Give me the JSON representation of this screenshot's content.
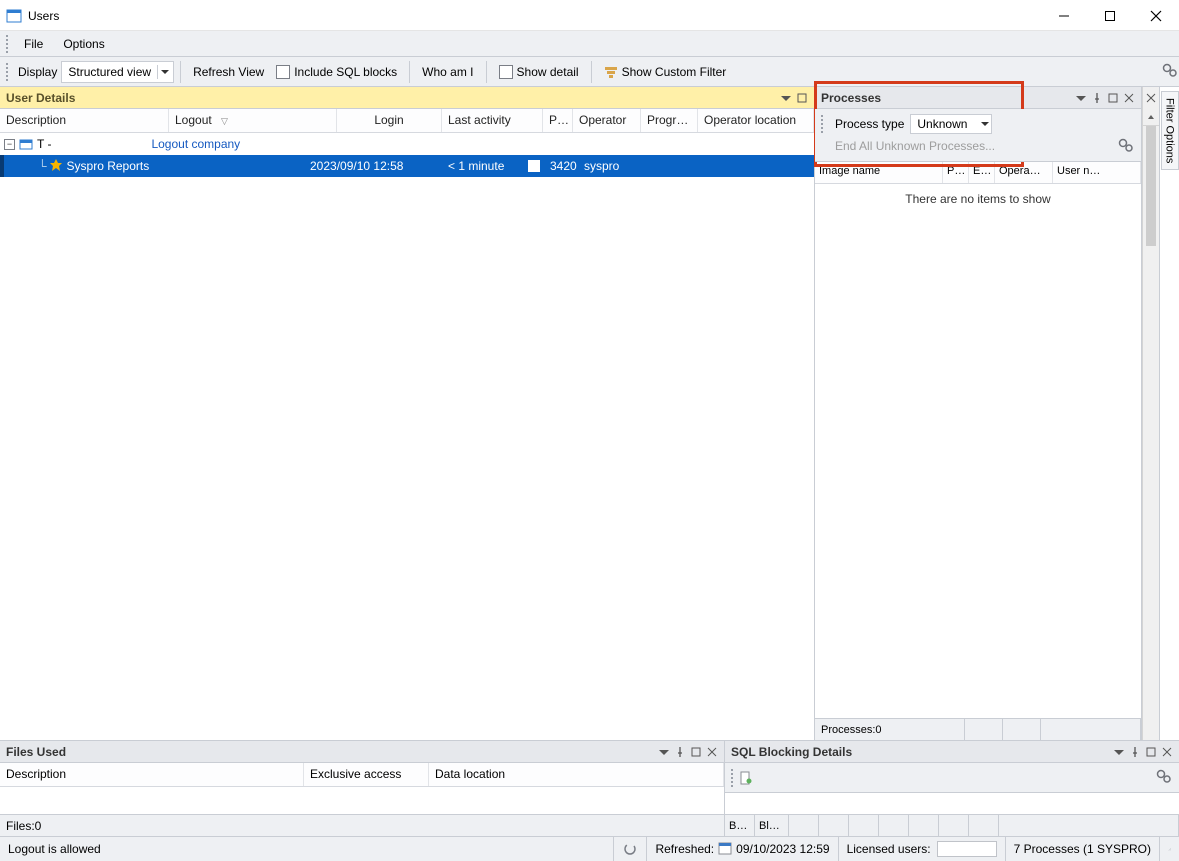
{
  "window": {
    "title": "Users"
  },
  "menu": {
    "file": "File",
    "options": "Options"
  },
  "toolbar": {
    "display_label": "Display",
    "display_value": "Structured view",
    "refresh": "Refresh View",
    "include_sql": "Include SQL blocks",
    "who_am_i": "Who am I",
    "show_detail": "Show detail",
    "show_custom_filter": "Show Custom Filter"
  },
  "user_details": {
    "title": "User Details",
    "columns": {
      "description": "Description",
      "logout": "Logout",
      "login": "Login",
      "last_activity": "Last activity",
      "pid": "PID",
      "operator": "Operator",
      "program": "Program",
      "operator_location": "Operator location"
    },
    "root": {
      "label": "T -",
      "logout_link": "Logout company"
    },
    "row": {
      "name": "Syspro Reports",
      "login": "2023/09/10 12:58",
      "last_activity": "< 1 minute",
      "pid": "3420",
      "operator": "syspro"
    }
  },
  "processes": {
    "title": "Processes",
    "type_label": "Process type",
    "type_value": "Unknown",
    "end_all": "End All Unknown Processes...",
    "columns": {
      "image": "Image name",
      "pid": "PID",
      "end": "End",
      "operator": "Opera…",
      "user": "User n…"
    },
    "empty": "There are no items to show",
    "count": "Processes:0"
  },
  "filter_tab": "Filter Options",
  "files_used": {
    "title": "Files Used",
    "columns": {
      "description": "Description",
      "exclusive": "Exclusive access",
      "data_location": "Data location"
    },
    "count": "Files:0"
  },
  "sql_block": {
    "title": "SQL Blocking Details",
    "status_cols": {
      "b1": "B…",
      "b2": "Bl…"
    }
  },
  "status": {
    "logout_allowed": "Logout is allowed",
    "refreshed_label": "Refreshed:",
    "refreshed_time": "09/10/2023 12:59",
    "licensed_users": "Licensed users:",
    "processes": "7 Processes (1 SYSPRO)"
  }
}
